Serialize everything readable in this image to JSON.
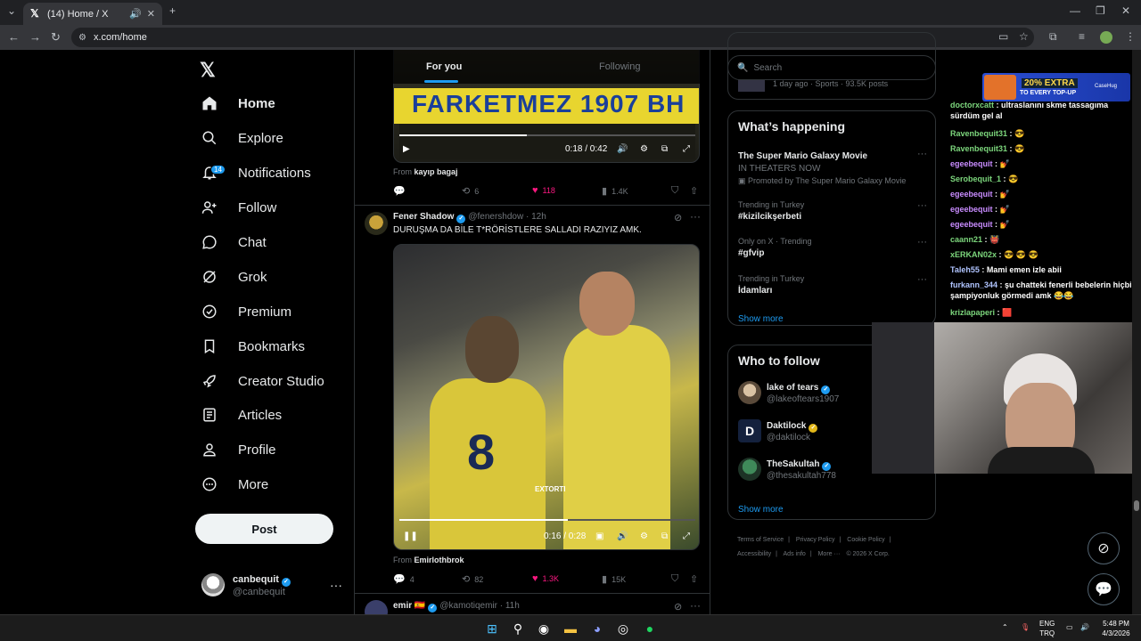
{
  "browser": {
    "tab_title": "(14) Home / X",
    "url": "x.com/home"
  },
  "nav": {
    "items": [
      {
        "label": "Home",
        "icon": "home-icon"
      },
      {
        "label": "Explore",
        "icon": "search-icon"
      },
      {
        "label": "Notifications",
        "icon": "bell-icon",
        "badge": "14"
      },
      {
        "label": "Follow",
        "icon": "add-person-icon"
      },
      {
        "label": "Chat",
        "icon": "chat-icon"
      },
      {
        "label": "Grok",
        "icon": "grok-icon"
      },
      {
        "label": "Premium",
        "icon": "premium-icon"
      },
      {
        "label": "Bookmarks",
        "icon": "bookmark-icon"
      },
      {
        "label": "Creator Studio",
        "icon": "rocket-icon"
      },
      {
        "label": "Articles",
        "icon": "article-icon"
      },
      {
        "label": "Profile",
        "icon": "person-icon"
      },
      {
        "label": "More",
        "icon": "more-icon"
      }
    ],
    "post_label": "Post",
    "account": {
      "name": "canbequit",
      "handle": "@canbequit"
    }
  },
  "feed": {
    "tabs": {
      "for_you": "For you",
      "following": "Following"
    },
    "tweet1": {
      "video_overlay_text": "FARKETMEZ 1907 BH",
      "video_time": "0:18 / 0:42",
      "video_progress": 0.43,
      "from_label": "From",
      "from_source": "kayıp bagaj",
      "stats": {
        "retweets": "6",
        "likes": "118",
        "views": "1.4K"
      }
    },
    "tweet2": {
      "name": "Fener Shadow",
      "handle": "@fenershdow",
      "time": "· 12h",
      "text": "DURUŞMA DA BİLE T*RÖRİSTLERE SALLADI RAZIYIZ AMK.",
      "video_watermark": "EXTORTI",
      "video_time": "0:16 / 0:28",
      "video_progress": 0.57,
      "from_label": "From",
      "from_source": "Emirlothbrok",
      "stats": {
        "replies": "4",
        "retweets": "82",
        "likes": "1.3K",
        "views": "15K"
      }
    },
    "tweet3": {
      "name": "emir",
      "handle": "@kamotiqemir",
      "time": "· 11h"
    }
  },
  "right": {
    "search_placeholder": "Search",
    "top_meta": "1 day ago · Sports · 93.5K posts",
    "whats_happening": {
      "title": "What’s happening",
      "trends": [
        {
          "context": "",
          "name": "The Super Mario Galaxy Movie",
          "sub": "IN THEATERS NOW",
          "promo": "Promoted by The Super Mario Galaxy Movie"
        },
        {
          "context": "Trending in Turkey",
          "name": "#kizilcikşerbeti",
          "sub": ""
        },
        {
          "context": "Only on X · Trending",
          "name": "#gfvip",
          "sub": ""
        },
        {
          "context": "Trending in Turkey",
          "name": "İdamları",
          "sub": ""
        }
      ],
      "show_more": "Show more"
    },
    "who_to_follow": {
      "title": "Who to follow",
      "accounts": [
        {
          "name": "lake of tears",
          "handle": "@lakeoftears1907",
          "verified": "blue"
        },
        {
          "name": "Daktilock",
          "handle": "@daktilock",
          "verified": "gold"
        },
        {
          "name": "TheSakultah",
          "handle": "@thesakultah778",
          "verified": "blue"
        }
      ],
      "show_more": "Show more"
    },
    "footer": [
      "Terms of Service",
      "|",
      "Privacy Policy",
      "|",
      "Cookie Policy",
      "|",
      "Accessibility",
      "|",
      "Ads info",
      "|",
      "More ···",
      "© 2026 X Corp."
    ]
  },
  "stream": {
    "promo": {
      "headline": "20% EXTRA",
      "sub": "TO EVERY TOP-UP",
      "brand": "CaseHug"
    },
    "chat": [
      {
        "user": "doctorxcatt",
        "color": "#7cd67c",
        "msg": ": ultraslanını skme tassagıma sürdüm gel al"
      },
      {
        "user": "Ravenbequit31",
        "color": "#7cd67c",
        "msg": ": 😎"
      },
      {
        "user": "Ravenbequit31",
        "color": "#7cd67c",
        "msg": ": 😎"
      },
      {
        "user": "egeebequit",
        "color": "#c98cff",
        "msg": ": 💅"
      },
      {
        "user": "Serobequit_1",
        "color": "#7cd67c",
        "msg": ": 😎"
      },
      {
        "user": "egeebequit",
        "color": "#c98cff",
        "msg": ": 💅"
      },
      {
        "user": "egeebequit",
        "color": "#c98cff",
        "msg": ": 💅"
      },
      {
        "user": "egeebequit",
        "color": "#c98cff",
        "msg": ": 💅"
      },
      {
        "user": "caann21",
        "color": "#7cd67c",
        "msg": ": 👹"
      },
      {
        "user": "xERKAN02x",
        "color": "#7cd67c",
        "msg": ": 😎 😎 😎"
      },
      {
        "user": "Taleh55",
        "color": "#b0c4ff",
        "msg": ": Mami emen izle abii"
      },
      {
        "user": "furkann_344",
        "color": "#b0c4ff",
        "msg": ": şu chatteki fenerli bebelerin hiçbiri şampiyonluk görmedi amk 😂😂"
      },
      {
        "user": "krizlapaperi",
        "color": "#7cd67c",
        "msg": ": 🟥"
      }
    ]
  },
  "taskbar": {
    "lang_top": "ENG",
    "lang_bottom": "TRQ",
    "time": "5:48 PM",
    "date": "4/3/2026"
  },
  "colors": {
    "accent": "#1d9bf0",
    "like": "#f91880",
    "gold": "#e2b719"
  }
}
